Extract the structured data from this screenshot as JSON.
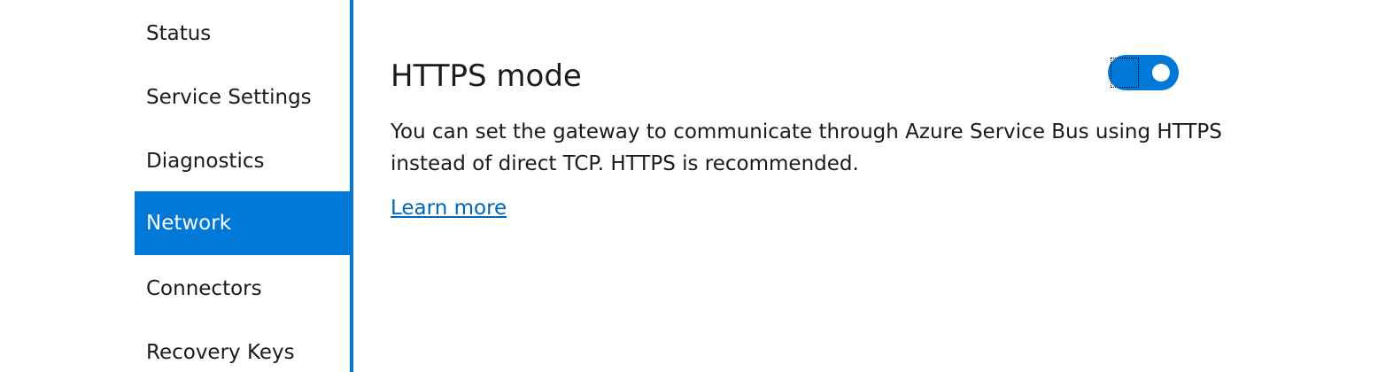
{
  "sidebar": {
    "items": [
      {
        "label": "Status",
        "active": false
      },
      {
        "label": "Service Settings",
        "active": false
      },
      {
        "label": "Diagnostics",
        "active": false
      },
      {
        "label": "Network",
        "active": true
      },
      {
        "label": "Connectors",
        "active": false
      },
      {
        "label": "Recovery Keys",
        "active": false
      }
    ]
  },
  "main": {
    "title": "HTTPS mode",
    "description": "You can set the gateway to communicate through Azure Service Bus using HTTPS instead of direct TCP. HTTPS is recommended.",
    "learn_more": "Learn more",
    "toggle_state": "on"
  },
  "colors": {
    "accent": "#0078d7",
    "link": "#0067b8",
    "text": "#1b1b1b",
    "background": "#ffffff"
  }
}
